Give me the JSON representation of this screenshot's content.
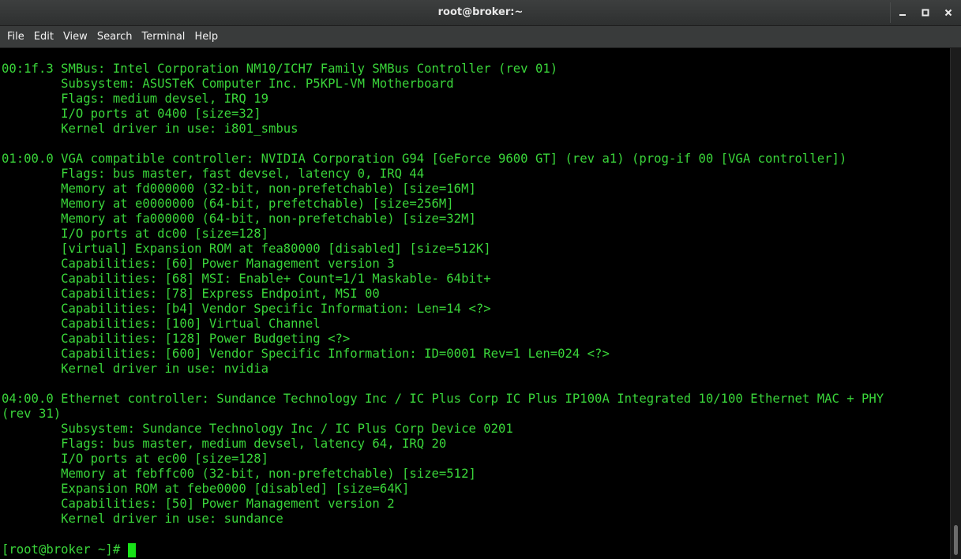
{
  "window": {
    "title": "root@broker:~",
    "controls": [
      "minimize-icon",
      "maximize-icon",
      "close-icon"
    ]
  },
  "menu": {
    "items": [
      "File",
      "Edit",
      "View",
      "Search",
      "Terminal",
      "Help"
    ]
  },
  "terminal": {
    "text_color": "#3ad53a",
    "background": "#000000",
    "lines": [
      "00:1f.3 SMBus: Intel Corporation NM10/ICH7 Family SMBus Controller (rev 01)",
      "        Subsystem: ASUSTeK Computer Inc. P5KPL-VM Motherboard",
      "        Flags: medium devsel, IRQ 19",
      "        I/O ports at 0400 [size=32]",
      "        Kernel driver in use: i801_smbus",
      "",
      "01:00.0 VGA compatible controller: NVIDIA Corporation G94 [GeForce 9600 GT] (rev a1) (prog-if 00 [VGA controller])",
      "        Flags: bus master, fast devsel, latency 0, IRQ 44",
      "        Memory at fd000000 (32-bit, non-prefetchable) [size=16M]",
      "        Memory at e0000000 (64-bit, prefetchable) [size=256M]",
      "        Memory at fa000000 (64-bit, non-prefetchable) [size=32M]",
      "        I/O ports at dc00 [size=128]",
      "        [virtual] Expansion ROM at fea80000 [disabled] [size=512K]",
      "        Capabilities: [60] Power Management version 3",
      "        Capabilities: [68] MSI: Enable+ Count=1/1 Maskable- 64bit+",
      "        Capabilities: [78] Express Endpoint, MSI 00",
      "        Capabilities: [b4] Vendor Specific Information: Len=14 <?>",
      "        Capabilities: [100] Virtual Channel",
      "        Capabilities: [128] Power Budgeting <?>",
      "        Capabilities: [600] Vendor Specific Information: ID=0001 Rev=1 Len=024 <?>",
      "        Kernel driver in use: nvidia",
      "",
      "04:00.0 Ethernet controller: Sundance Technology Inc / IC Plus Corp IC Plus IP100A Integrated 10/100 Ethernet MAC + PHY",
      "(rev 31)",
      "        Subsystem: Sundance Technology Inc / IC Plus Corp Device 0201",
      "        Flags: bus master, medium devsel, latency 64, IRQ 20",
      "        I/O ports at ec00 [size=128]",
      "        Memory at febffc00 (32-bit, non-prefetchable) [size=512]",
      "        Expansion ROM at febe0000 [disabled] [size=64K]",
      "        Capabilities: [50] Power Management version 2",
      "        Kernel driver in use: sundance"
    ],
    "prompt": "[root@broker ~]# "
  }
}
